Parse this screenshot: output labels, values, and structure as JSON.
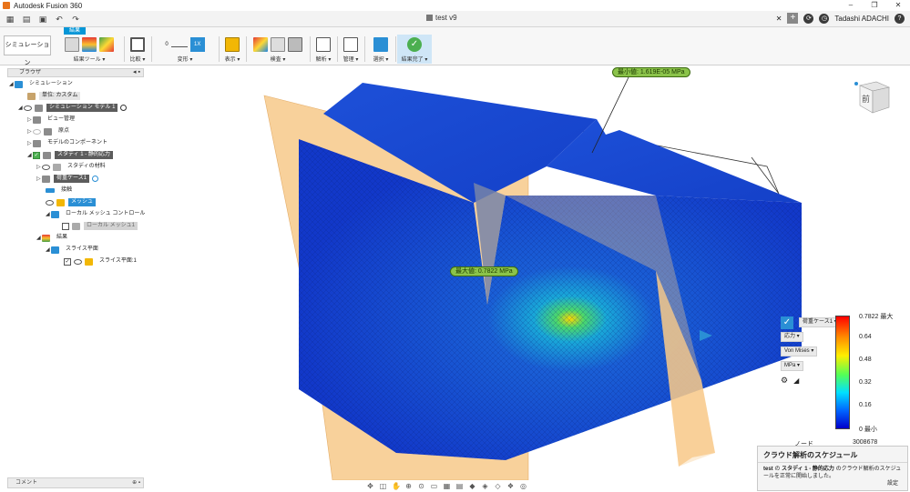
{
  "app": {
    "title": "Autodesk Fusion 360",
    "doc_title": "test v9",
    "user": "Tadashi ADACHI"
  },
  "ribbon": {
    "workspace": "シミュレーション",
    "active_tab": "結果",
    "groups": [
      "結果ツール ▾",
      "比較 ▾",
      "変形 ▾",
      "表示 ▾",
      "検査 ▾",
      "解析 ▾",
      "管理 ▾",
      "選択 ▾",
      "結果完了 ▾"
    ],
    "deform_value": "0",
    "deform_btn": "1X"
  },
  "browser": {
    "title": "ブラウザ",
    "items": [
      {
        "label": "シミュレーション"
      },
      {
        "label": "単位: カスタム"
      },
      {
        "label": "シミュレーション モデル 1"
      },
      {
        "label": "ビュー管理"
      },
      {
        "label": "原点"
      },
      {
        "label": "モデルのコンポーネント"
      },
      {
        "label": "スタディ 1 - 静的応力"
      },
      {
        "label": "スタディの材料"
      },
      {
        "label": "荷重ケース1"
      },
      {
        "label": "接触"
      },
      {
        "label": "メッシュ"
      },
      {
        "label": "ローカル メッシュ コントロール"
      },
      {
        "label": "ローカル メッシュ1"
      },
      {
        "label": "結果"
      },
      {
        "label": "スライス平面"
      },
      {
        "label": "スライス平面:1"
      }
    ]
  },
  "comments": {
    "label": "コメント"
  },
  "callouts": {
    "min": "最小値: 1.619E-05 MPa",
    "max": "最大値: 0.7822 MPa"
  },
  "legend": {
    "load_case": "荷重ケース1 ▾",
    "result_type": "応力 ▾",
    "criterion": "Von Mises ▾",
    "unit": "MPa ▾",
    "ticks": [
      "0.7822 最大",
      "0.64",
      "0.48",
      "0.32",
      "0.16",
      "0 最小"
    ],
    "nodes_label": "ノード",
    "nodes_value": "3008678"
  },
  "notification": {
    "title": "クラウド解析のスケジュール",
    "body_1": "test",
    "body_2": " の ",
    "body_3": "スタディ 1 - 静的応力",
    "body_4": " のクラウド解析のスケジュールを正常に開始しました。",
    "close": "設定"
  },
  "viewcube": {
    "face": "前"
  },
  "colors": {
    "accent": "#0696d7",
    "callout": "#8bc34a",
    "slice_plane": "#f7c98a",
    "mesh_blue": "#1238c9"
  }
}
